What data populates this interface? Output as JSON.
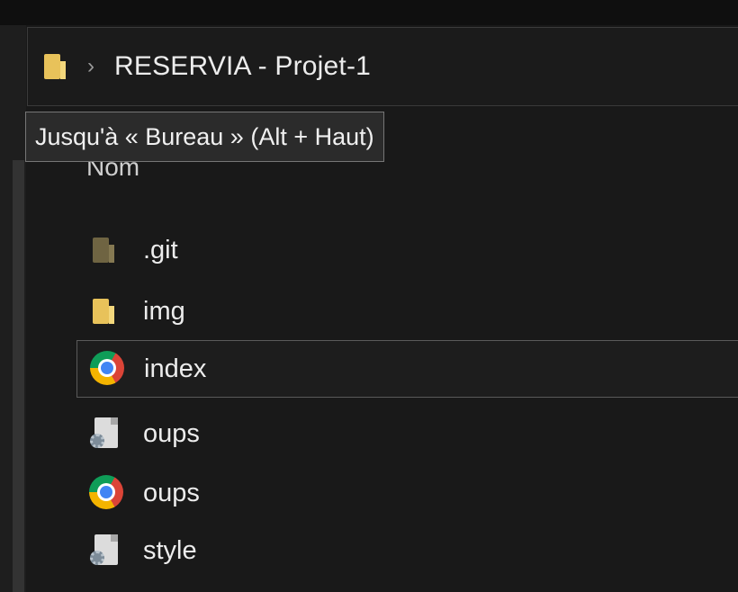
{
  "window": {
    "address": {
      "icon": "folder-icon",
      "separator": "›",
      "crumbs": [
        "RESERVIA - Projet-1"
      ]
    },
    "tooltip": "Jusqu'à « Bureau » (Alt + Haut)",
    "list": {
      "column_name": "Nom",
      "items": [
        {
          "name": ".git",
          "icon": "hidden-folder-icon"
        },
        {
          "name": "img",
          "icon": "folder-icon"
        },
        {
          "name": "index",
          "icon": "chrome-html-icon",
          "selected": true
        },
        {
          "name": "oups",
          "icon": "settings-file-icon"
        },
        {
          "name": "oups",
          "icon": "chrome-html-icon"
        },
        {
          "name": "style",
          "icon": "settings-file-icon"
        }
      ]
    }
  },
  "colors": {
    "background": "#191919",
    "folder": "#e8c25a",
    "selection_border": "#5a5a5a",
    "tooltip_border": "#767676"
  }
}
